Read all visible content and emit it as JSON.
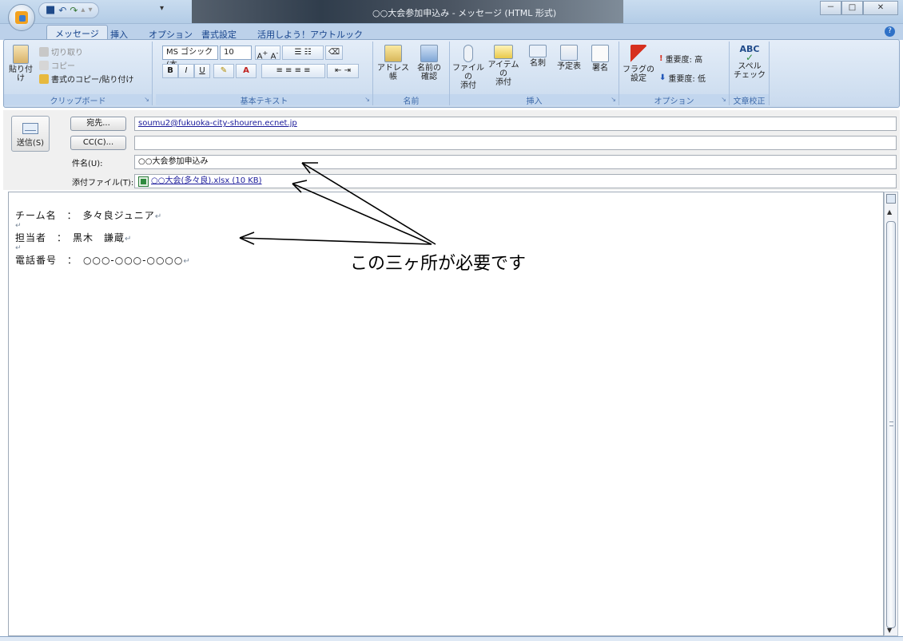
{
  "window": {
    "title": "○○大会参加申込み - メッセージ (HTML 形式)",
    "controls": {
      "minimize": "－",
      "maximize": "□",
      "close": "✕"
    }
  },
  "quick_access": {
    "save": "■",
    "undo": "↶",
    "redo": "↷",
    "up": "▴",
    "down": "▾",
    "more": "▾"
  },
  "tabs": [
    "メッセージ",
    "挿入",
    "オプション",
    "書式設定",
    "活用しよう！アウトルック"
  ],
  "ribbon": {
    "clipboard": {
      "paste": "貼り付け",
      "cut": "切り取り",
      "copy": "コピー",
      "format_painter": "書式のコピー/貼り付け",
      "label": "クリップボード"
    },
    "basic_text": {
      "font": "MS ゴシック (本",
      "size": "10",
      "label": "基本テキスト",
      "bold": "B",
      "italic": "I",
      "underline": "U"
    },
    "names": {
      "address_book": "アドレス帳",
      "check_names_1": "名前の",
      "check_names_2": "確認",
      "label": "名前"
    },
    "insert": {
      "attach_file_1": "ファイルの",
      "attach_file_2": "添付",
      "attach_item_1": "アイテムの",
      "attach_item_2": "添付",
      "business_card": "名刺",
      "calendar": "予定表",
      "signature": "署名",
      "label": "挿入"
    },
    "options": {
      "flag_1": "フラグの",
      "flag_2": "設定",
      "high": "重要度: 高",
      "low": "重要度: 低",
      "label": "オプション"
    },
    "proofing": {
      "spelling_1": "スペル",
      "spelling_2": "チェック",
      "abc": "ABC",
      "label": "文章校正"
    }
  },
  "compose": {
    "send": "送信(S)",
    "to_button": "宛先...",
    "cc_button": "CC(C)...",
    "to_value": "soumu2@fukuoka-city-shouren.ecnet.jp",
    "cc_value": "",
    "subject_label": "件名(U):",
    "subject_value": "○○大会参加申込み",
    "attach_label": "添付ファイル(T):",
    "attach_value": "○○大会(多々良).xlsx (10 KB)"
  },
  "body": {
    "line1": "チーム名　：　多々良ジュニア",
    "line2": "担当者　：　黒木　謙蔵",
    "line3": "電話番号　：　○○○-○○○-○○○○",
    "return_mark": "↵"
  },
  "annotation": "この三ヶ所が必要です"
}
